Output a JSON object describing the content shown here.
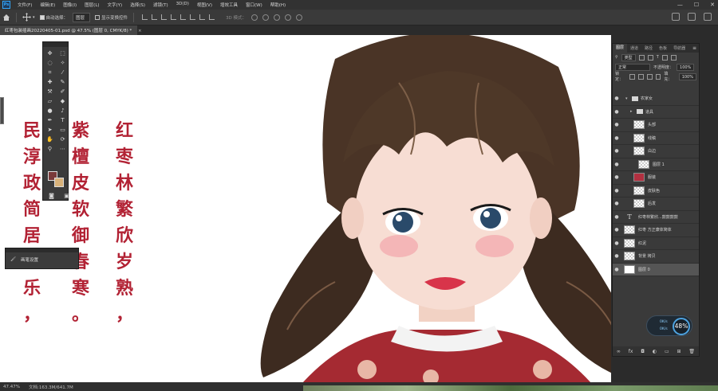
{
  "app": {
    "logo": "Ps"
  },
  "menu": [
    "文件(F)",
    "编辑(E)",
    "图像(I)",
    "图层(L)",
    "文字(Y)",
    "选择(S)",
    "滤镜(T)",
    "3D(D)",
    "视图(V)",
    "增效工具",
    "窗口(W)",
    "帮助(H)"
  ],
  "window_controls": {
    "minimize": "—",
    "maximize": "☐",
    "close": "✕"
  },
  "options": {
    "auto_select_label": "自动选择：",
    "auto_select_value": "图层",
    "show_transform_label": "显示变换控件",
    "mode3d_label": "3D 模式："
  },
  "document_tab": {
    "title": "红枣包装插画20220405-01.psd @ 47.5% (图层 0, CMYK/8) *",
    "close": "×"
  },
  "canvas": {
    "poem_columns": [
      [
        "红",
        "枣",
        "林",
        "繁",
        "欣",
        "岁",
        "熟",
        "，"
      ],
      [
        "紫",
        "檀",
        "皮",
        "软",
        "御",
        "春",
        "寒",
        "。"
      ],
      [
        "民",
        "淳",
        "政",
        "简",
        "居",
        "",
        "乐",
        "，"
      ]
    ]
  },
  "brush_panel": {
    "label": "画笔设置"
  },
  "layers_panel": {
    "tabs": [
      "图层",
      "通道",
      "路径",
      "色板",
      "导航器"
    ],
    "filter_label": "类型",
    "blend_mode": "正常",
    "opacity_label": "不透明度：",
    "opacity_value": "100%",
    "lock_label": "锁定：",
    "fill_label": "填充：",
    "fill_value": "100%",
    "layers": [
      {
        "name": "农家女",
        "kind": "folder",
        "indent": 0,
        "selected": false
      },
      {
        "name": "道具",
        "kind": "folder",
        "indent": 1,
        "selected": false
      },
      {
        "name": "头部",
        "kind": "pixel",
        "indent": 2,
        "selected": false
      },
      {
        "name": "线稿",
        "kind": "pixel",
        "indent": 2,
        "selected": false
      },
      {
        "name": "白边",
        "kind": "pixel",
        "indent": 2,
        "selected": false
      },
      {
        "name": "图层 1",
        "kind": "pixel",
        "indent": 3,
        "selected": false
      },
      {
        "name": "服装",
        "kind": "red",
        "indent": 2,
        "selected": false
      },
      {
        "name": "皮肤色",
        "kind": "pixel",
        "indent": 2,
        "selected": false
      },
      {
        "name": "后发",
        "kind": "pixel",
        "indent": 2,
        "selected": false
      },
      {
        "name": "红枣林繁欣...鼓鼓鼓鼓",
        "kind": "type",
        "indent": 0,
        "selected": false
      },
      {
        "name": "红枣 方正康体简体",
        "kind": "pixel",
        "indent": 0,
        "selected": false
      },
      {
        "name": "红泥",
        "kind": "pixel",
        "indent": 0,
        "selected": false
      },
      {
        "name": "背景 拷贝",
        "kind": "pixel",
        "indent": 0,
        "selected": false
      },
      {
        "name": "图层 0",
        "kind": "white",
        "indent": 0,
        "selected": true
      }
    ],
    "footer": [
      "∞",
      "fx",
      "◘",
      "◐",
      "▭",
      "⊞",
      "🗑"
    ]
  },
  "performance": {
    "up": "0K/s",
    "down": "0K/s",
    "percent": "48%"
  },
  "status": {
    "zoom": "47.47%",
    "doc": "文档:163.3M/641.7M"
  }
}
